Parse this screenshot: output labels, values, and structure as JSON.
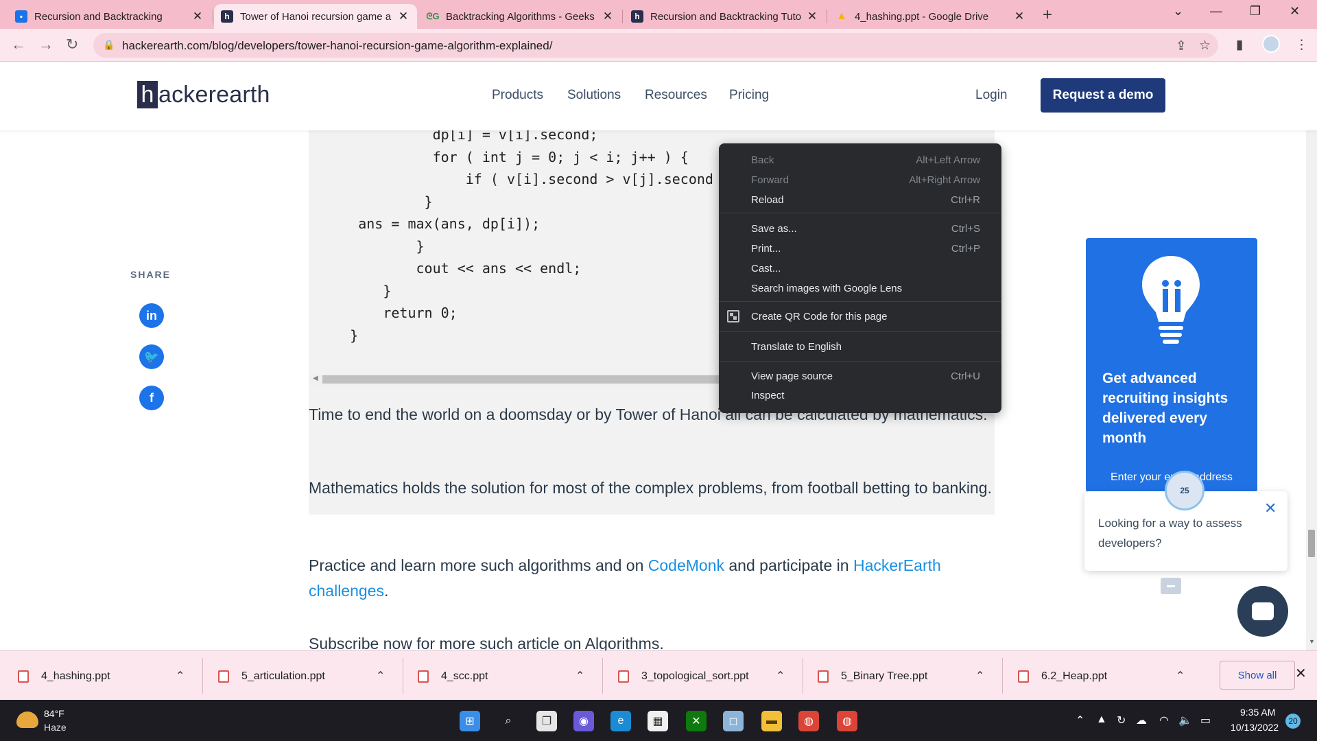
{
  "browser": {
    "tabs": [
      {
        "title": "Recursion and Backtracking",
        "favicon": "classroom-icon",
        "color": "#1a73e8"
      },
      {
        "title": "Tower of Hanoi recursion game a",
        "favicon": "hackerearth-icon",
        "color": "#2b2e4a"
      },
      {
        "title": "Backtracking Algorithms - Geeks",
        "favicon": "geeksforgeeks-icon",
        "color": "#2f8d46"
      },
      {
        "title": "Recursion and Backtracking Tuto",
        "favicon": "hackerearth-icon",
        "color": "#2b2e4a"
      },
      {
        "title": "4_hashing.ppt - Google Drive",
        "favicon": "google-drive-icon",
        "color": "#f4b400"
      }
    ],
    "active_tab": 1,
    "url": "hackerearth.com/blog/developers/tower-hanoi-recursion-game-algorithm-explained/"
  },
  "site": {
    "logo_h": "h",
    "logo_rest": "ackerearth",
    "nav": [
      "Products",
      "Solutions",
      "Resources",
      "Pricing"
    ],
    "login": "Login",
    "demo_button": "Request a demo"
  },
  "code_lines": [
    "              dp[i] = v[i].second;",
    "              for ( int j = 0; j < i; j++ ) {",
    "                  if ( v[i].second > v[j].second &",
    "             }",
    "     ans = max(ans, dp[i]);",
    "            }",
    "            cout << ans << endl;",
    "        }",
    "        return 0;",
    "    }"
  ],
  "share": {
    "label": "SHARE",
    "networks": [
      "linkedin-icon",
      "twitter-icon",
      "facebook-icon"
    ]
  },
  "article": {
    "p1": "Time to end the world on a doomsday or by Tower of Hanoi all can be calculated by mathematics.",
    "p2": "Mathematics holds the solution for most of the complex problems, from football betting to banking.",
    "p3_a": "Practice and learn more such algorithms and on ",
    "p3_link1": "CodeMonk",
    "p3_b": " and participate in ",
    "p3_link2": "HackerEarth challenges",
    "p3_c": ".",
    "p4": "Subscribe now for more such article on Algorithms."
  },
  "promo": {
    "title": "Get advanced recruiting insights delivered every month",
    "email_placeholder": "Enter your email address"
  },
  "chat": {
    "message": "Looking for a way to assess developers?",
    "avatar_text": "25"
  },
  "context_menu": {
    "items": [
      {
        "label": "Back",
        "shortcut": "Alt+Left Arrow",
        "disabled": true
      },
      {
        "label": "Forward",
        "shortcut": "Alt+Right Arrow",
        "disabled": true
      },
      {
        "label": "Reload",
        "shortcut": "Ctrl+R",
        "disabled": false
      },
      {
        "label": "Save as...",
        "shortcut": "Ctrl+S",
        "disabled": false
      },
      {
        "label": "Print...",
        "shortcut": "Ctrl+P",
        "disabled": false
      },
      {
        "label": "Cast...",
        "shortcut": "",
        "disabled": false
      },
      {
        "label": "Search images with Google Lens",
        "shortcut": "",
        "disabled": false
      },
      {
        "label": "Create QR Code for this page",
        "shortcut": "",
        "disabled": false
      },
      {
        "label": "Translate to English",
        "shortcut": "",
        "disabled": false
      },
      {
        "label": "View page source",
        "shortcut": "Ctrl+U",
        "disabled": false
      },
      {
        "label": "Inspect",
        "shortcut": "",
        "disabled": false
      }
    ]
  },
  "downloads": {
    "files": [
      "4_hashing.ppt",
      "5_articulation.ppt",
      "4_scc.ppt",
      "3_topological_sort.ppt",
      "5_Binary Tree.ppt",
      "6.2_Heap.ppt"
    ],
    "show_all": "Show all"
  },
  "taskbar": {
    "temperature": "84°F",
    "weather": "Haze",
    "time": "9:35 AM",
    "date": "10/13/2022",
    "notifications": "20"
  }
}
